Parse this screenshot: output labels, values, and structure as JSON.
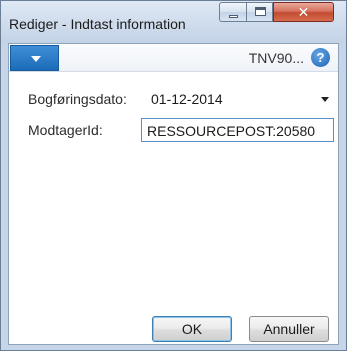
{
  "window": {
    "title": "Rediger - Indtast information",
    "close_glyph": "✕"
  },
  "header": {
    "title": "TNV90...",
    "help_glyph": "?"
  },
  "fields": {
    "posting_date": {
      "label": "Bogføringsdato:",
      "value": "01-12-2014"
    },
    "receiver_id": {
      "label": "ModtagerId:",
      "value": "RESSOURCEPOST:20580"
    }
  },
  "buttons": {
    "ok": "OK",
    "cancel": "Annuller"
  },
  "colors": {
    "menu_accent": "#1c6bb9",
    "close_button": "#c24a30",
    "help_icon": "#1a62b3"
  },
  "icons": {
    "menu": "chevron-down-icon",
    "help": "help-icon",
    "dropdown": "chevron-down-icon",
    "minimize": "minimize-icon",
    "maximize": "maximize-icon",
    "close": "close-icon"
  }
}
